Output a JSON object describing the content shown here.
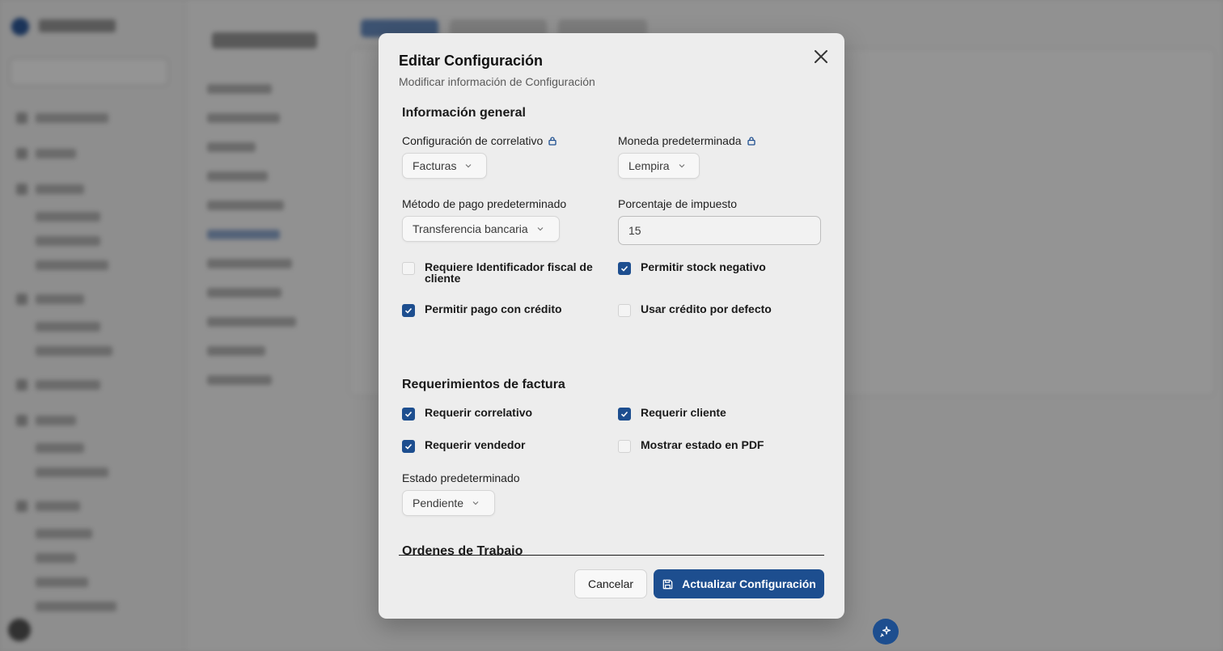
{
  "modal": {
    "title": "Editar Configuración",
    "subtitle": "Modificar información de Configuración",
    "close_icon": "close-icon"
  },
  "general": {
    "section_title": "Información general",
    "correlativo_label": "Configuración de correlativo",
    "correlativo_value": "Facturas",
    "moneda_label": "Moneda predeterminada",
    "moneda_value": "Lempira",
    "metodo_label": "Método de pago predeterminado",
    "metodo_value": "Transferencia bancaria",
    "impuesto_label": "Porcentaje de impuesto",
    "impuesto_value": "15",
    "checks": [
      {
        "label": "Requiere Identificador fiscal de cliente",
        "checked": false
      },
      {
        "label": "Permitir stock negativo",
        "checked": true
      },
      {
        "label": "Permitir pago con crédito",
        "checked": true
      },
      {
        "label": "Usar crédito por defecto",
        "checked": false
      }
    ]
  },
  "factura": {
    "section_title": "Requerimientos de factura",
    "checks": [
      {
        "label": "Requerir correlativo",
        "checked": true
      },
      {
        "label": "Requerir cliente",
        "checked": true
      },
      {
        "label": "Requerir vendedor",
        "checked": true
      },
      {
        "label": "Mostrar estado en PDF",
        "checked": false
      }
    ],
    "estado_label": "Estado predeterminado",
    "estado_value": "Pendiente"
  },
  "ordenes": {
    "section_title": "Ordenes de Trabajo"
  },
  "footer": {
    "cancel_label": "Cancelar",
    "submit_label": "Actualizar Configuración"
  },
  "colors": {
    "accent": "#1d4e8f"
  }
}
